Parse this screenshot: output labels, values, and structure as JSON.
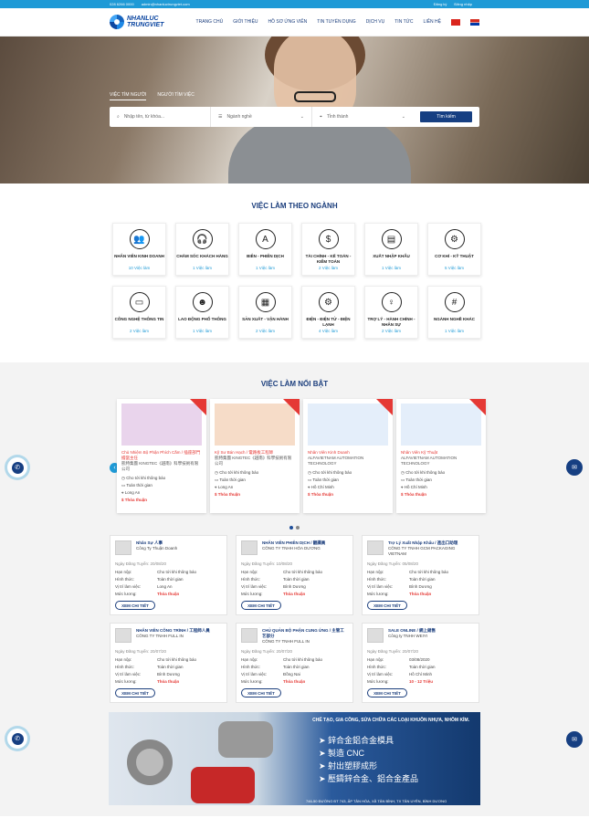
{
  "topbar": {
    "phone": "028 6266 0000",
    "email": "admin@nhanluctrungviet.com",
    "login": "Đăng ký",
    "signup": "Đăng nhập"
  },
  "logo": {
    "line1": "NHANLUC",
    "line2": "TRUNGVIET"
  },
  "menu": [
    "TRANG CHỦ",
    "GIỚI THIỆU",
    "HỒ SƠ ỨNG VIÊN",
    "TIN TUYỂN DỤNG",
    "DỊCH VỤ",
    "TIN TỨC",
    "LIÊN HỆ"
  ],
  "hero": {
    "tab1": "VIỆC TÌM NGƯỜI",
    "tab2": "NGƯỜI TÌM VIỆC",
    "keyword_ph": "Nhập tên, từ khóa...",
    "field_ph": "Ngành nghề",
    "place_ph": "Tỉnh thành",
    "search_btn": "Tìm kiếm"
  },
  "section1": "VIỆC LÀM THEO NGÀNH",
  "categories": [
    {
      "name": "NHÂN VIÊN KINH DOANH",
      "count": "10 Việc làm",
      "icon": "👥"
    },
    {
      "name": "CHĂM SÓC KHÁCH HÀNG",
      "count": "1 Việc làm",
      "icon": "🎧"
    },
    {
      "name": "BIÊN - PHIÊN DỊCH",
      "count": "1 Việc làm",
      "icon": "A"
    },
    {
      "name": "TÀI CHÍNH - KẾ TOÁN - KIỂM TOÁN",
      "count": "2 Việc làm",
      "icon": "$"
    },
    {
      "name": "XUẤT NHẬP KHẨU",
      "count": "1 Việc làm",
      "icon": "▤"
    },
    {
      "name": "CƠ KHÍ - KỸ THUẬT",
      "count": "5 Việc làm",
      "icon": "⚙"
    },
    {
      "name": "CÔNG NGHỆ THÔNG TIN",
      "count": "2 Việc làm",
      "icon": "▭"
    },
    {
      "name": "LAO ĐỘNG PHỔ THÔNG",
      "count": "1 Việc làm",
      "icon": "☻"
    },
    {
      "name": "SẢN XUẤT - VẬN HÀNH",
      "count": "2 Việc làm",
      "icon": "▦"
    },
    {
      "name": "ĐIỆN - ĐIỆN TỬ - ĐIỆN LẠNH",
      "count": "4 Việc làm",
      "icon": "⚙"
    },
    {
      "name": "TRỢ LÝ - HÀNH CHÍNH - NHÂN SỰ",
      "count": "2 Việc làm",
      "icon": "♀"
    },
    {
      "name": "NGÀNH NGHỀ KHÁC",
      "count": "1 Việc làm",
      "icon": "#"
    }
  ],
  "section2": "VIỆC LÀM NỔI BẬT",
  "featured": [
    {
      "title": "Chủ Nhiệm Bộ Phận Phích Cắm / 插座部門擔當主任",
      "company": "凱特集團 KINGTEC《越南》科學技術有限公司",
      "deadline": "Cho tới khi thông báo",
      "type": "Toàn thời gian",
      "place": "Long An",
      "salary": "Thỏa thuận",
      "bg": "#e9d4ec"
    },
    {
      "title": "Kỹ Sư Bán Hạch / 電路板工程師",
      "company": "凱特集團 KINGTEC《越南》科學技術有限公司",
      "deadline": "Cho tới khi thông báo",
      "type": "Toàn thời gian",
      "place": "Long An",
      "salary": "Thỏa thuận",
      "bg": "#f6dcc8"
    },
    {
      "title": "Nhân Viên Kinh Doanh",
      "company": "ALFAVIETNAM AUTOMATION TECHNOLOGY",
      "deadline": "Cho tới khi thông báo",
      "type": "Toàn thời gian",
      "place": "Hồ Chí Minh",
      "salary": "Thỏa thuận",
      "bg": "#e4eefa"
    },
    {
      "title": "Nhân Viên Kỹ Thuật",
      "company": "ALFAVIETNAM AUTOMATION TECHNOLOGY",
      "deadline": "Cho tới khi thông báo",
      "type": "Toàn thời gian",
      "place": "Hồ Chí Minh",
      "salary": "Thỏa thuận",
      "bg": "#e4eefa"
    }
  ],
  "labels": {
    "deadline": "Hạn nộp:",
    "type": "Hình thức:",
    "place": "Vị trí làm việc:",
    "salary": "Mức lương:",
    "more": "XEM CHI TIẾT"
  },
  "jobs": [
    {
      "title": "Nhân Sự 人事",
      "company": "Công Ty Thuận Doanh",
      "date": "Ngày Đăng Tuyển: 20/08/20",
      "deadline": "Cho tới khi thông báo",
      "type": "Toàn thời gian",
      "place": "Long An",
      "salary": "Thỏa thuận"
    },
    {
      "title": "NHÂN VIÊN PHIÊN DỊCH / 翻譯員",
      "company": "CÔNG TY TNHH HÓA DƯƠNG",
      "date": "Ngày Đăng Tuyển: 10/08/20",
      "deadline": "Cho tới khi thông báo",
      "type": "Toàn thời gian",
      "place": "Bình Dương",
      "salary": "Thỏa thuận"
    },
    {
      "title": "Trợ Lý Xuất Nhập Khẩu / 進出口助理",
      "company": "CÔNG TY TNHH GCM PACKAGING VIETNAM",
      "date": "Ngày Đăng Tuyển: 05/08/20",
      "deadline": "Cho tới khi thông báo",
      "type": "Toàn thời gian",
      "place": "Bình Dương",
      "salary": "Thỏa thuận"
    },
    {
      "title": "NHÂN VIÊN CÔNG TRÌNH / 工程師人員",
      "company": "CÔNG TY TNHH FULL IN",
      "date": "Ngày Đăng Tuyển: 20/07/20",
      "deadline": "Cho tới khi thông báo",
      "type": "Toàn thời gian",
      "place": "Bình Dương",
      "salary": "Thỏa thuận"
    },
    {
      "title": "CHỦ QUẢN BỘ PHẬN CUNG ỨNG / 主管工艺部分",
      "company": "CÔNG TY TNHH FULL IN",
      "date": "Ngày Đăng Tuyển: 20/07/20",
      "deadline": "Cho tới khi thông báo",
      "type": "Toàn thời gian",
      "place": "Đồng Nai",
      "salary": "Thỏa thuận"
    },
    {
      "title": "SALE ONLINE / 網上銷售",
      "company": "Công ty TNHH WEIYI",
      "date": "Ngày Đăng Tuyển: 20/07/20",
      "deadline": "03/08/2020",
      "type": "Toàn thời gian",
      "place": "Hồ Chí Minh",
      "salary": "10 - 12 Triệu"
    }
  ],
  "banner": {
    "title": "CHẾ TẠO, GIA CÔNG, SỬA CHỮA CÁC LOẠI KHUÔN NHỰA, NHÔM KÍM.",
    "items": [
      "鋅合金鋁合金模具",
      "製造 CNC",
      "射出塑膠成形",
      "壓鑄鋅合金、鋁合金產品"
    ],
    "address": "746-50 ĐƯỜNG ĐT 743, ẤP TÂN HÒA, XÃ TÂN BÌNH, TX TÂN UYÊN, BÌNH DƯƠNG"
  }
}
